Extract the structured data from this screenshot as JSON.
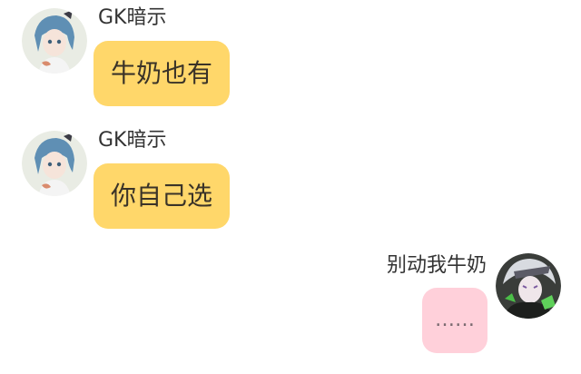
{
  "messages": [
    {
      "sender": "GK暗示",
      "text": "牛奶也有",
      "side": "left",
      "bubble_color": "#ffd76a"
    },
    {
      "sender": "GK暗示",
      "text": "你自己选",
      "side": "left",
      "bubble_color": "#ffd76a"
    },
    {
      "sender": "别动我牛奶",
      "text": "……",
      "side": "right",
      "bubble_color": "#ffd0da"
    }
  ],
  "avatars": {
    "left": "anime-girl-blue-hair-avatar",
    "right": "anime-boy-green-black-avatar"
  }
}
